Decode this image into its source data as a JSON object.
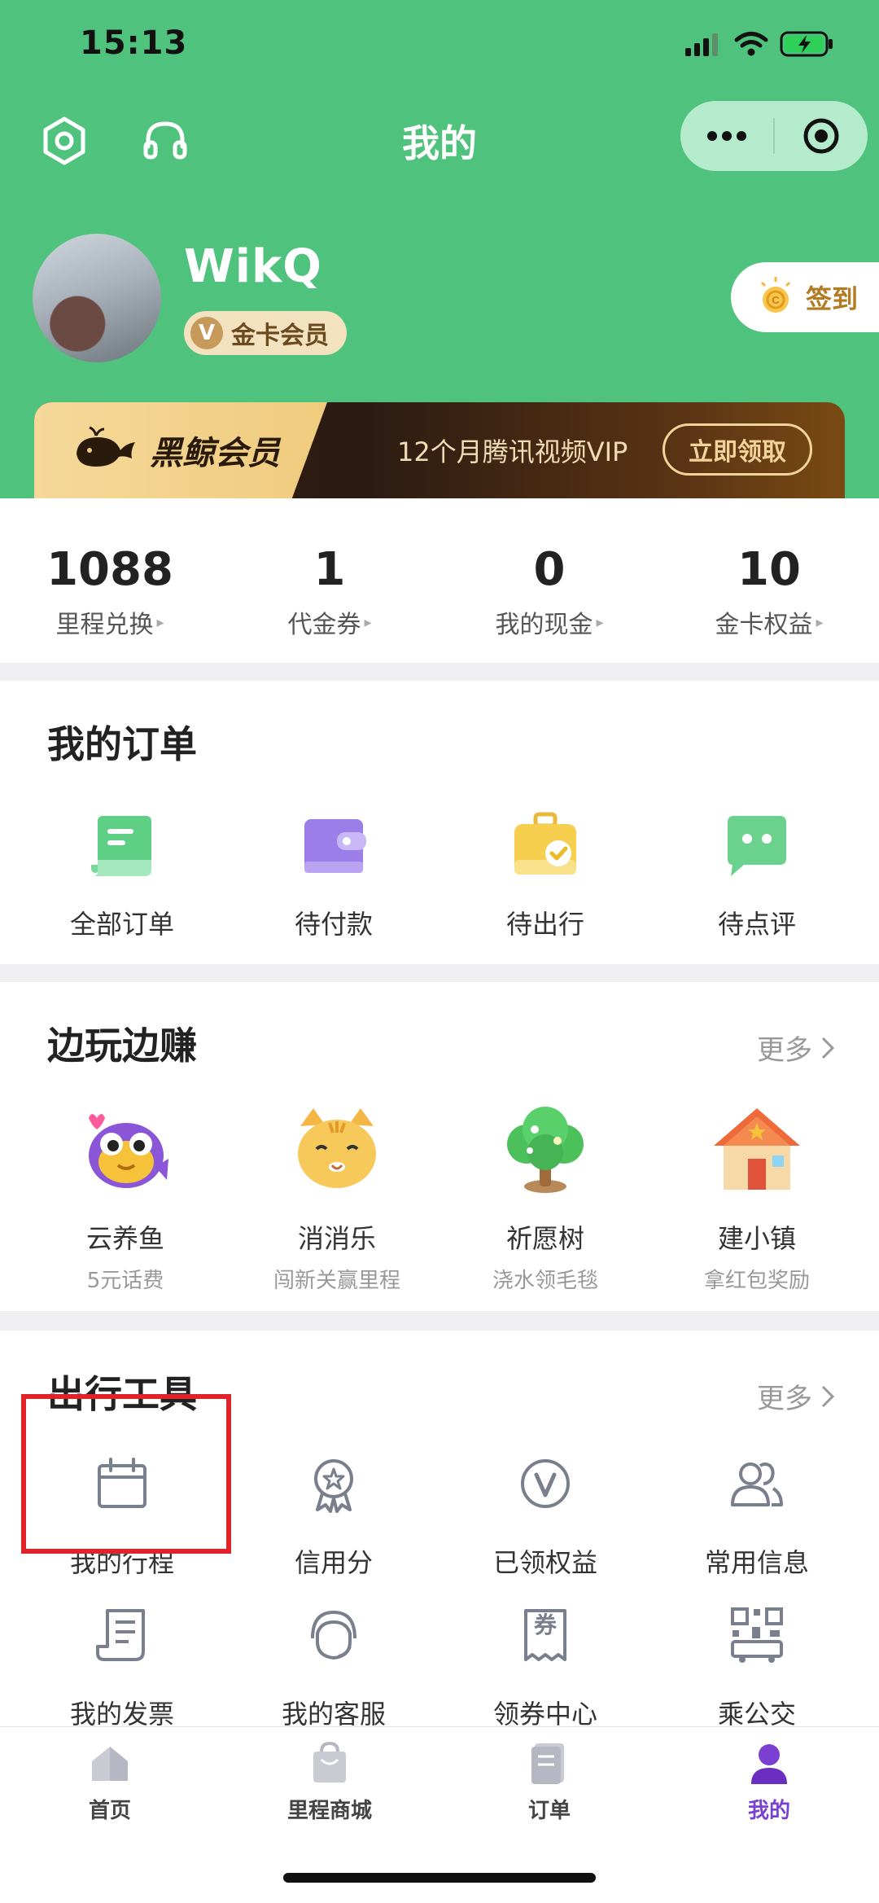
{
  "status_bar": {
    "time": "15:13"
  },
  "nav": {
    "title": "我的"
  },
  "profile": {
    "username": "WikQ",
    "member_badge_icon": "V",
    "member_level": "金卡会员",
    "checkin_label": "签到"
  },
  "vip_banner": {
    "brand": "黑鲸会员",
    "promo_text": "12个月腾讯视频VIP",
    "button_label": "立即领取"
  },
  "stats": [
    {
      "value": "1088",
      "label": "里程兑换"
    },
    {
      "value": "1",
      "label": "代金券"
    },
    {
      "value": "0",
      "label": "我的现金"
    },
    {
      "value": "10",
      "label": "金卡权益"
    }
  ],
  "orders": {
    "title": "我的订单",
    "items": [
      {
        "label": "全部订单",
        "icon": "document-icon"
      },
      {
        "label": "待付款",
        "icon": "wallet-icon"
      },
      {
        "label": "待出行",
        "icon": "suitcase-icon"
      },
      {
        "label": "待点评",
        "icon": "chat-bubble-icon"
      }
    ]
  },
  "games": {
    "title": "边玩边赚",
    "more": "更多",
    "items": [
      {
        "label": "云养鱼",
        "sub": "5元话费"
      },
      {
        "label": "消消乐",
        "sub": "闯新关赢里程"
      },
      {
        "label": "祈愿树",
        "sub": "浇水领毛毯"
      },
      {
        "label": "建小镇",
        "sub": "拿红包奖励"
      }
    ]
  },
  "tools": {
    "title": "出行工具",
    "more": "更多",
    "items": [
      {
        "label": "我的行程"
      },
      {
        "label": "信用分"
      },
      {
        "label": "已领权益",
        "icon_text": "V"
      },
      {
        "label": "常用信息"
      },
      {
        "label": "我的发票"
      },
      {
        "label": "我的客服"
      },
      {
        "label": "领券中心",
        "icon_text": "券"
      },
      {
        "label": "乘公交"
      }
    ]
  },
  "tabbar": [
    {
      "label": "首页"
    },
    {
      "label": "里程商城"
    },
    {
      "label": "订单"
    },
    {
      "label": "我的",
      "active": true
    }
  ],
  "colors": {
    "header_green": "#4fc37d",
    "accent_purple": "#7b3fd1",
    "highlight_red": "#e0232a",
    "gold": "#c69a5b"
  }
}
